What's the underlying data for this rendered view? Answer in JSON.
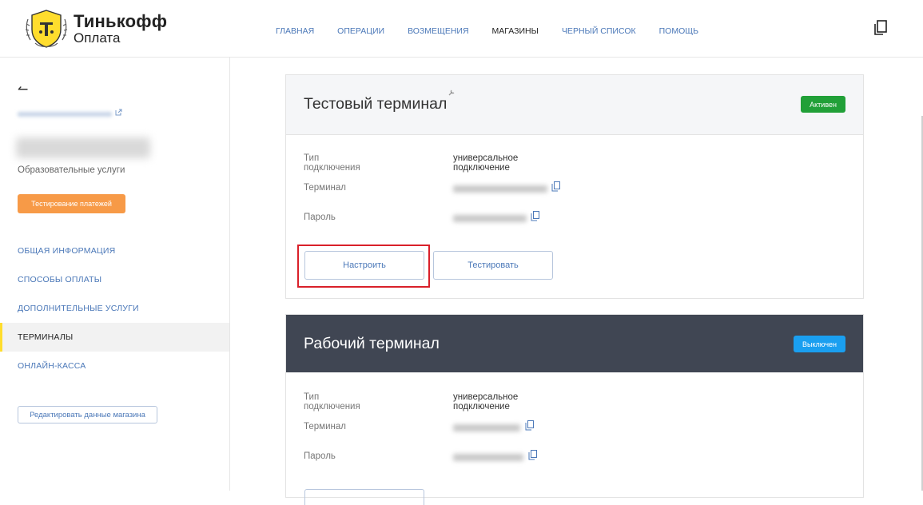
{
  "header": {
    "brand": "Тинькофф",
    "subbrand": "Оплата",
    "nav": [
      {
        "label": "ГЛАВНАЯ",
        "active": false
      },
      {
        "label": "ОПЕРАЦИИ",
        "active": false
      },
      {
        "label": "ВОЗМЕЩЕНИЯ",
        "active": false
      },
      {
        "label": "МАГАЗИНЫ",
        "active": true
      },
      {
        "label": "ЧЕРНЫЙ СПИСОК",
        "active": false
      },
      {
        "label": "ПОМОЩЬ",
        "active": false
      }
    ],
    "copy_icon": "copy-icon"
  },
  "sidebar": {
    "back_icon": "back-arrow-icon",
    "category": "Образовательные услуги",
    "test_badge": "Тестирование платежей",
    "menu": [
      {
        "label": "ОБЩАЯ ИНФОРМАЦИЯ",
        "active": false
      },
      {
        "label": "СПОСОБЫ ОПЛАТЫ",
        "active": false
      },
      {
        "label": "ДОПОЛНИТЕЛЬНЫЕ УСЛУГИ",
        "active": false
      },
      {
        "label": "ТЕРМИНАЛЫ",
        "active": true
      },
      {
        "label": "ОНЛАЙН-КАССА",
        "active": false
      }
    ],
    "edit_button": "Редактировать данные магазина"
  },
  "terminals": [
    {
      "title": "Тестовый терминал",
      "status": "Активен",
      "status_color": "#21a038",
      "rows": [
        {
          "label": "Тип подключения",
          "value": "универсальное подключение"
        },
        {
          "label": "Терминал",
          "value": ""
        },
        {
          "label": "Пароль",
          "value": ""
        }
      ],
      "buttons": {
        "configure": "Настроить",
        "test": "Тестировать"
      }
    },
    {
      "title": "Рабочий терминал",
      "status": "Выключен",
      "status_color": "#1a9ff0",
      "rows": [
        {
          "label": "Тип подключения",
          "value": "универсальное подключение"
        },
        {
          "label": "Терминал",
          "value": ""
        },
        {
          "label": "Пароль",
          "value": ""
        }
      ]
    }
  ],
  "colors": {
    "accent_link": "#4b78b8",
    "highlight_box": "#d9202a",
    "dark_header": "#404653",
    "yellow_marker": "#ffdd2d"
  }
}
